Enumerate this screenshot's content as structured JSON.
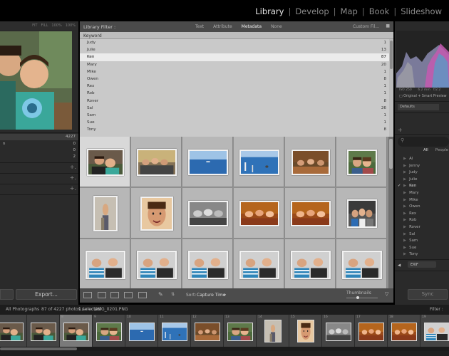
{
  "module_bar": {
    "modules": [
      "Library",
      "Develop",
      "Map",
      "Book",
      "Slideshow"
    ],
    "active": "Library"
  },
  "navigator": {
    "zoom_options": [
      "FIT",
      "FILL",
      "100%",
      "100%"
    ]
  },
  "catalog": {
    "count": "4227",
    "counts": [
      "0",
      "0",
      "2"
    ]
  },
  "left_buttons": {
    "export": "Export..."
  },
  "filter_bar": {
    "title": "Library Filter :",
    "tabs": [
      "Text",
      "Attribute",
      "Metadata",
      "None"
    ],
    "active_tab": "Metadata",
    "preset": "Custom Fil..."
  },
  "keyword_panel": {
    "header": "Keyword",
    "rows": [
      {
        "name": "Judy",
        "count": "1"
      },
      {
        "name": "Julie",
        "count": "13"
      },
      {
        "name": "Ken",
        "count": "87"
      },
      {
        "name": "Mary",
        "count": "20"
      },
      {
        "name": "Mike",
        "count": "1"
      },
      {
        "name": "Owen",
        "count": "8"
      },
      {
        "name": "Rex",
        "count": "1"
      },
      {
        "name": "Rob",
        "count": "1"
      },
      {
        "name": "Rover",
        "count": "8"
      },
      {
        "name": "Sal",
        "count": "26"
      },
      {
        "name": "Sam",
        "count": "1"
      },
      {
        "name": "Sue",
        "count": "1"
      },
      {
        "name": "Tony",
        "count": "8"
      }
    ],
    "selected": "Ken"
  },
  "toolbar": {
    "sort_label": "Sort:",
    "sort_value": "Capture Time",
    "thumbnails_label": "Thumbnails"
  },
  "right_panel": {
    "histogram_info": [
      "ISO 250",
      "6.2 mm",
      "f/2.2"
    ],
    "smart_preview": "Original + Smart Preview",
    "defaults": "Defaults",
    "keyword_tabs": [
      "All",
      "People"
    ],
    "keywords": [
      "Al",
      "Jenny",
      "Judy",
      "Julie",
      "Ken",
      "Mary",
      "Mike",
      "Owen",
      "Rex",
      "Rob",
      "Rover",
      "Sal",
      "Sam",
      "Sue",
      "Tony"
    ],
    "checked_keyword": "Ken",
    "metadata_preset": "EXIF",
    "sync_label": "Sync"
  },
  "filmstrip": {
    "source": "All Photographs",
    "status": "87 of 4227 photos /",
    "selected_text": "1 selected",
    "filename": "/IMG_0201.PNG",
    "filter_label": "Filter :",
    "numbers": [
      "6",
      "",
      "8",
      "9",
      "10",
      "11",
      "12",
      "13",
      "14",
      "15",
      "16",
      "17",
      "18",
      "19",
      "20"
    ]
  },
  "colors": {
    "accent_active": "#e6e6e6",
    "panel_bg": "#2a2a2a",
    "grid_bg": "#909090",
    "keyword_bg": "#c9c9c9"
  }
}
